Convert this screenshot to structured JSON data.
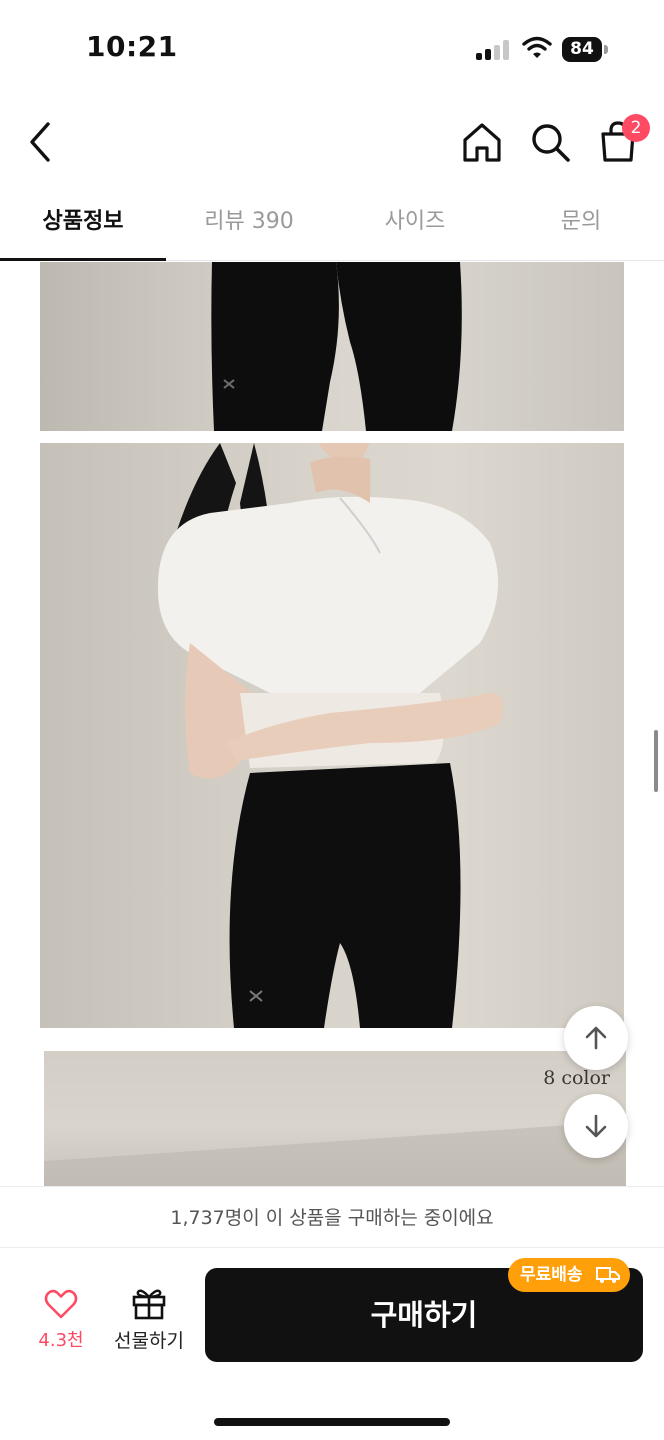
{
  "status_bar": {
    "time": "10:21",
    "battery": "84"
  },
  "header": {
    "back_icon": "chevron-left-icon",
    "home_icon": "home-icon",
    "search_icon": "search-icon",
    "cart_icon": "shopping-bag-icon",
    "cart_count": "2"
  },
  "tabs": [
    {
      "label": "상품정보",
      "active": true
    },
    {
      "label": "리뷰 390",
      "active": false
    },
    {
      "label": "사이즈",
      "active": false
    },
    {
      "label": "문의",
      "active": false
    }
  ],
  "content": {
    "photo_3_label": "8 color",
    "scroll_up_icon": "arrow-up-icon",
    "scroll_down_icon": "arrow-down-icon"
  },
  "purchase_notice": "1,737명이 이 상품을 구매하는 중이에요",
  "bottom_bar": {
    "like_count": "4.3천",
    "gift_label": "선물하기",
    "buy_label": "구매하기",
    "shipping_badge": "무료배송"
  },
  "colors": {
    "accent_pink": "#ff4a64",
    "badge_orange": "#ff9f0a",
    "buy_button": "#111111"
  }
}
